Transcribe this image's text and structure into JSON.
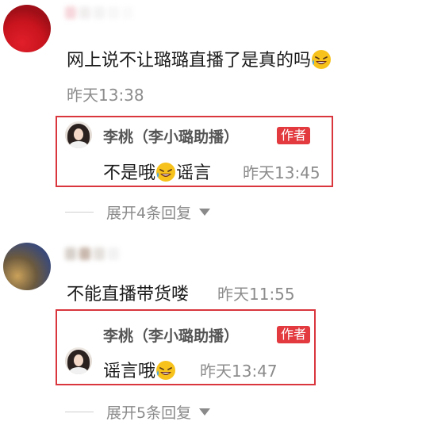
{
  "comments": [
    {
      "text": "网上说不让璐璐直播了是真的吗",
      "time": "昨天13:38",
      "reply": {
        "name": "李桃（李小璐助播）",
        "badge": "作者",
        "text_before": "不是哦",
        "text_after": "谣言",
        "time": "昨天13:45"
      },
      "expand_label": "展开4条回复"
    },
    {
      "text": "不能直播带货喽",
      "time": "昨天11:55",
      "reply": {
        "name": "李桃（李小璐助播）",
        "badge": "作者",
        "text_before": "谣言哦",
        "text_after": "",
        "time": "昨天13:47"
      },
      "expand_label": "展开5条回复"
    }
  ],
  "icons": {
    "emoji": "rolling-on-floor-laughing-icon",
    "caret": "caret-down-icon"
  },
  "colors": {
    "highlight_border": "#d9363e",
    "author_badge": "#e23a3f"
  }
}
